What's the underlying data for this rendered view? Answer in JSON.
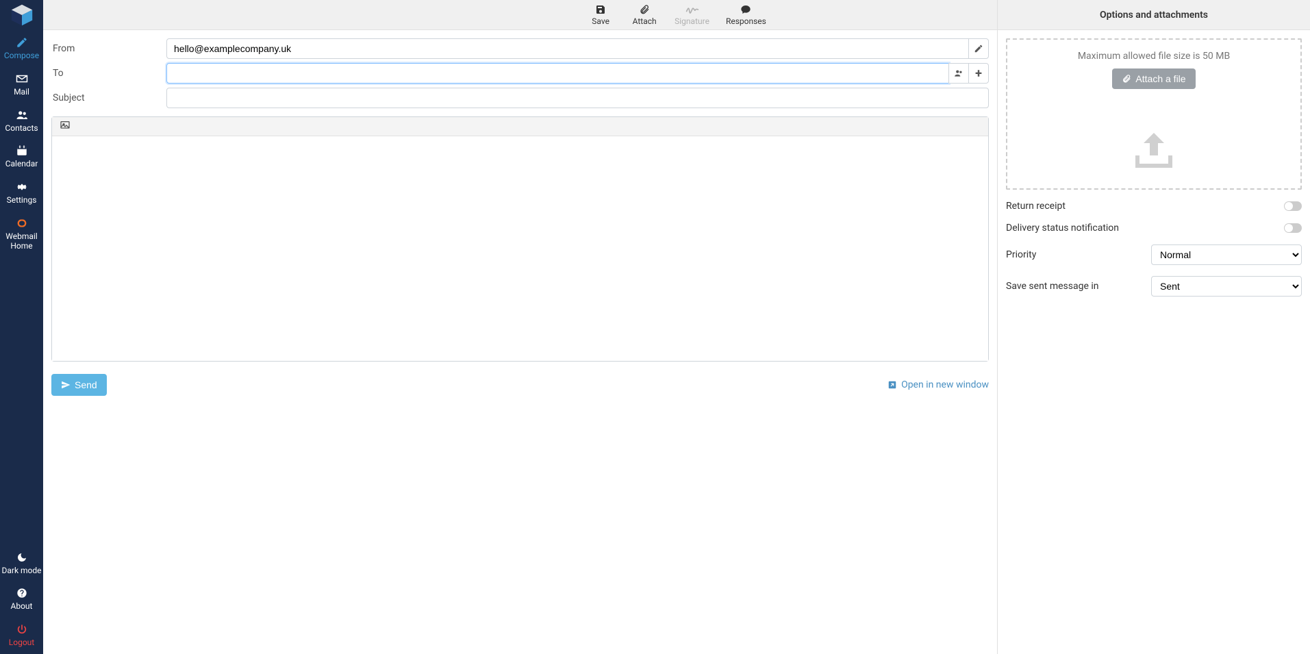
{
  "sidebar": {
    "compose": "Compose",
    "mail": "Mail",
    "contacts": "Contacts",
    "calendar": "Calendar",
    "settings": "Settings",
    "webmail_home": "Webmail Home",
    "dark_mode": "Dark mode",
    "about": "About",
    "logout": "Logout"
  },
  "toolbar": {
    "save": "Save",
    "attach": "Attach",
    "signature": "Signature",
    "responses": "Responses"
  },
  "options": {
    "title": "Options and attachments",
    "max_size": "Maximum allowed file size is 50 MB",
    "attach_file": "Attach a file",
    "return_receipt": "Return receipt",
    "delivery_status": "Delivery status notification",
    "priority_label": "Priority",
    "priority_value": "Normal",
    "save_sent_label": "Save sent message in",
    "save_sent_value": "Sent"
  },
  "compose": {
    "from_label": "From",
    "from_value": "hello@examplecompany.uk",
    "to_label": "To",
    "to_value": "",
    "subject_label": "Subject",
    "subject_value": "",
    "body_value": "",
    "send": "Send",
    "open_new": "Open in new window"
  }
}
